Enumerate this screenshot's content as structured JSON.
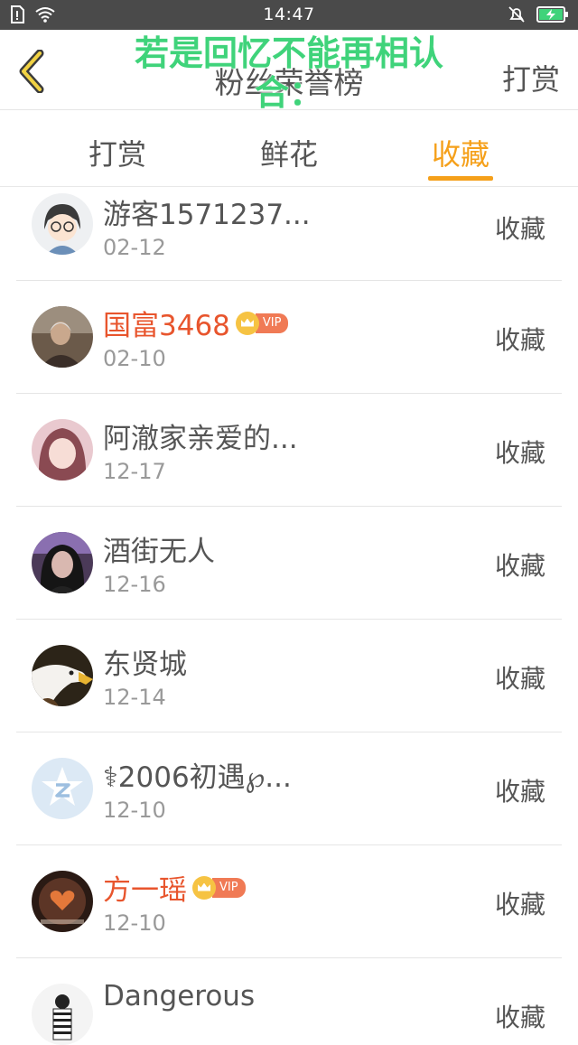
{
  "status": {
    "time": "14:47"
  },
  "header": {
    "title": "粉丝荣誉榜",
    "overlay": "若是回忆不能再相认 合：",
    "action": "打赏"
  },
  "tabs": [
    {
      "label": "打赏",
      "active": false
    },
    {
      "label": "鲜花",
      "active": false
    },
    {
      "label": "收藏",
      "active": true
    }
  ],
  "list": [
    {
      "name": "游客1571237...",
      "date": "02-12",
      "action": "收藏",
      "vip": false,
      "avatar": "cartoon-girl-glasses"
    },
    {
      "name": "国富3468",
      "date": "02-10",
      "action": "收藏",
      "vip": true,
      "vip_label": "VIP",
      "avatar": "old-man"
    },
    {
      "name": "阿澈家亲爱的...",
      "date": "12-17",
      "action": "收藏",
      "vip": false,
      "avatar": "girl-pink-hair"
    },
    {
      "name": "酒街无人",
      "date": "12-16",
      "action": "收藏",
      "vip": false,
      "avatar": "girl-dark"
    },
    {
      "name": "东贤城",
      "date": "12-14",
      "action": "收藏",
      "vip": false,
      "avatar": "eagle"
    },
    {
      "name": "⚕2006初遇℘...",
      "date": "12-10",
      "action": "收藏",
      "vip": false,
      "avatar": "default-star"
    },
    {
      "name": "方一瑶",
      "date": "12-10",
      "action": "收藏",
      "vip": true,
      "vip_label": "VIP",
      "avatar": "heart-hand"
    },
    {
      "name": "Dangerous",
      "date": "",
      "action": "收藏",
      "vip": false,
      "avatar": "person-striped"
    }
  ],
  "colors": {
    "accent": "#f5a01a",
    "vip_name": "#e8552d",
    "overlay": "#3fd37a"
  }
}
